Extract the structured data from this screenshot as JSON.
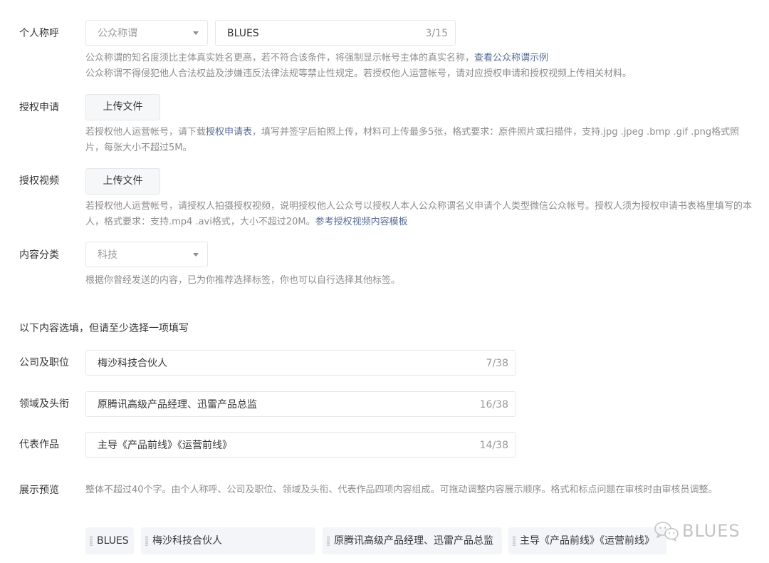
{
  "name_row": {
    "label": "个人称呼",
    "select_value": "公众称谓",
    "input_value": "BLUES",
    "input_count": "3/15",
    "hint_line1": "公众称谓的知名度须比主体真实姓名更高，若不符合该条件，将强制显示帐号主体的真实名称，",
    "hint_link": "查看公众称谓示例",
    "hint_line2": "公众称谓不得侵犯他人合法权益及涉嫌违反法律法规等禁止性规定。若授权他人运营帐号，请对应授权申请和授权视频上传相关材料。"
  },
  "auth_apply": {
    "label": "授权申请",
    "button": "上传文件",
    "hint_before": "若授权他人运营帐号，请下载",
    "hint_link": "授权申请表",
    "hint_after": "，填写并签字后拍照上传，材料可上传最多5张，格式要求：原件照片或扫描件，支持.jpg .jpeg .bmp .gif .png格式照片，每张大小不超过5M。"
  },
  "auth_video": {
    "label": "授权视频",
    "button": "上传文件",
    "hint_before": "若授权他人运营帐号，请授权人拍摄授权视频，说明授权他人公众号以授权人本人公众称谓名义申请个人类型微信公众帐号。授权人须为授权申请书表格里填写的本人，格式要求：支持.mp4 .avi格式，大小不超过20M。",
    "hint_link": "参考授权视频内容模板"
  },
  "category": {
    "label": "内容分类",
    "select_value": "科技",
    "hint": "根据你曾经发送的内容，已为你推荐选择标签，你也可以自行选择其他标签。"
  },
  "optional_title": "以下内容选填，但请至少选择一项填写",
  "company": {
    "label": "公司及职位",
    "value": "梅沙科技合伙人",
    "count": "7/38"
  },
  "field": {
    "label": "领域及头衔",
    "value": "原腾讯高级产品经理、迅雷产品总监",
    "count": "16/38"
  },
  "works": {
    "label": "代表作品",
    "value": "主导《产品前线》《运营前线》",
    "count": "14/38"
  },
  "preview": {
    "label": "展示预览",
    "hint": "整体不超过40个字。由个人称呼、公司及职位、领域及头衔、代表作品四项内容组成。可拖动调整内容展示顺序。格式和标点问题在审核时由审核员调整。",
    "tags": [
      "BLUES",
      "梅沙科技合伙人",
      "原腾讯高级产品经理、迅雷产品总监",
      "主导《产品前线》《运营前线》"
    ]
  },
  "watermark": {
    "text": "BLUES",
    "icon": "wechat-icon"
  },
  "colors": {
    "link": "#576b95",
    "hint": "#8d8d8d",
    "border": "#e4e8eb",
    "tag_bg": "#f4f5f9"
  }
}
